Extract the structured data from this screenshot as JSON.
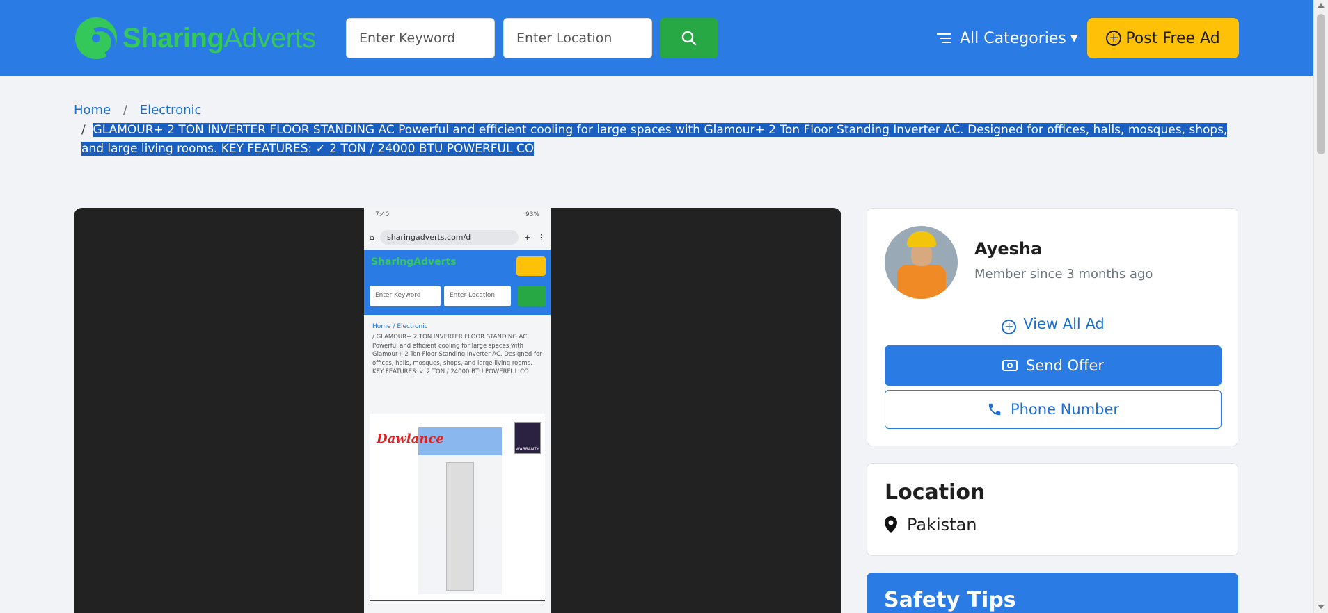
{
  "header": {
    "logo_part1": "Sharing",
    "logo_part2": "Adverts",
    "keyword_placeholder": "Enter Keyword",
    "location_placeholder": "Enter Location",
    "categories_label": "All Categories",
    "post_ad_label": "Post Free Ad",
    "brand_color": "#2a7be4"
  },
  "breadcrumb": {
    "home": "Home",
    "category": "Electronic",
    "title": "GLAMOUR+ 2 TON INVERTER FLOOR STANDING AC Powerful and efficient cooling for large spaces with Glamour+ 2 Ton Floor Standing Inverter AC. Designed for offices, halls, mosques, shops, and large living rooms. KEY FEATURES: ✓ 2 TON / 24000 BTU POWERFUL CO"
  },
  "media": {
    "screenshot": {
      "status_time": "7:40",
      "status_battery": "93%",
      "url": "sharingadverts.com/d",
      "logo": "SharingAdverts",
      "keyword_placeholder": "Enter Keyword",
      "location_placeholder": "Enter Location",
      "crumb": "Home  /  Electronic",
      "text": "/  GLAMOUR+ 2 TON INVERTER FLOOR STANDING AC Powerful and efficient cooling for large spaces with Glamour+ 2 Ton Floor Standing Inverter AC. Designed for offices, halls, mosques, shops, and large living rooms. KEY FEATURES: ✓ 2 TON / 24000 BTU POWERFUL CO",
      "brand": "Dawlance",
      "badge": "WARRANTY"
    }
  },
  "seller": {
    "name": "Ayesha",
    "member_since": "Member since 3 months ago",
    "view_all": "View All Ad",
    "send_offer": "Send Offer",
    "phone_number": "Phone Number"
  },
  "location": {
    "title": "Location",
    "value": "Pakistan"
  },
  "safety": {
    "title": "Safety Tips"
  }
}
